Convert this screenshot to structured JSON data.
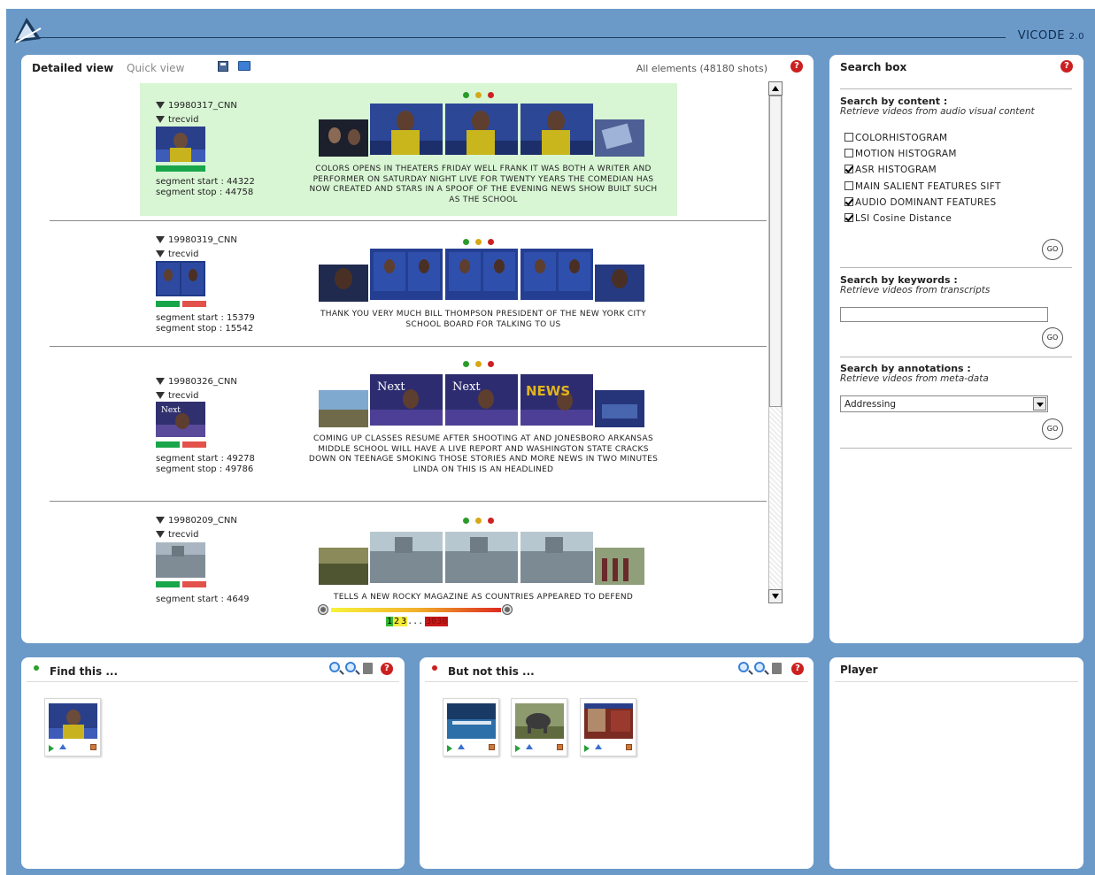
{
  "app": {
    "title": "VICODE",
    "version": "2.0"
  },
  "results_panel": {
    "tab_active": "Detailed view",
    "tab_inactive": "Quick view",
    "count_text": "All elements (48180 shots)",
    "help_glyph": "?",
    "items": [
      {
        "video_id": "19980317_CNN",
        "collection": "trecvid",
        "seg_start": "segment start : 44322",
        "seg_stop": "segment stop : 44758",
        "transcript": "COLORS OPENS IN THEATERS FRIDAY WELL FRANK IT WAS BOTH A WRITER AND PERFORMER ON SATURDAY NIGHT LIVE FOR TWENTY YEARS THE COMEDIAN HAS NOW CREATED AND STARS IN A SPOOF OF THE EVENING NEWS SHOW BUILT SUCH AS THE SCHOOL",
        "highlighted": true
      },
      {
        "video_id": "19980319_CNN",
        "collection": "trecvid",
        "seg_start": "segment start : 15379",
        "seg_stop": "segment stop : 15542",
        "transcript": "THANK YOU VERY MUCH BILL THOMPSON PRESIDENT OF THE NEW YORK CITY SCHOOL BOARD FOR TALKING TO US",
        "highlighted": false
      },
      {
        "video_id": "19980326_CNN",
        "collection": "trecvid",
        "seg_start": "segment start : 49278",
        "seg_stop": "segment stop : 49786",
        "transcript": "COMING UP CLASSES RESUME AFTER SHOOTING AT AND JONESBORO ARKANSAS MIDDLE SCHOOL WILL HAVE A LIVE REPORT AND WASHINGTON STATE CRACKS DOWN ON TEENAGE SMOKING THOSE STORIES AND MORE NEWS IN TWO MINUTES LINDA ON THIS IS AN HEADLINED",
        "highlighted": false
      },
      {
        "video_id": "19980209_CNN",
        "collection": "trecvid",
        "seg_start": "segment start : 4649",
        "seg_stop": "",
        "transcript": "TELLS A NEW ROCKY MAGAZINE AS COUNTRIES APPEARED TO DEFEND",
        "highlighted": false
      }
    ],
    "pager": {
      "p1": "1",
      "p2": "2",
      "p3": "3",
      "ellipsis": "...",
      "last": "3030"
    }
  },
  "search_panel": {
    "title": "Search box",
    "content_title": "Search by content :",
    "content_sub": "Retrieve videos from audio visual content",
    "options": [
      {
        "label": "COLORHISTOGRAM",
        "checked": false
      },
      {
        "label": "MOTION HISTOGRAM",
        "checked": false
      },
      {
        "label": "ASR HISTOGRAM",
        "checked": true
      },
      {
        "label": "MAIN SALIENT FEATURES SIFT",
        "checked": false
      },
      {
        "label": "AUDIO DOMINANT FEATURES",
        "checked": true
      },
      {
        "label": "LSI Cosine Distance",
        "checked": true
      }
    ],
    "go_label": "GO",
    "keywords_title": "Search by keywords :",
    "keywords_sub": "Retrieve videos from transcripts",
    "keywords_value": "",
    "annotations_title": "Search by annotations :",
    "annotations_sub": "Retrieve videos from meta-data",
    "annotation_selected": "Addressing"
  },
  "find_panel": {
    "title": "Find this ...",
    "dot_color": "#2aa02a"
  },
  "notthis_panel": {
    "title": "But not this ...",
    "dot_color": "#c92020"
  },
  "player_panel": {
    "title": "Player"
  }
}
